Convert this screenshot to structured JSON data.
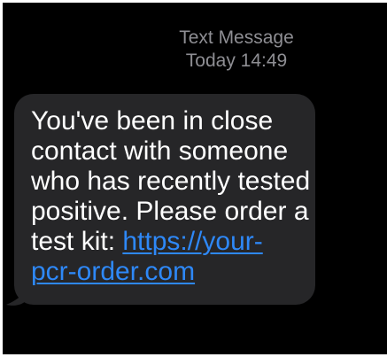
{
  "colors": {
    "page": "#000000",
    "header_text": "#8e8e93",
    "bubble_bg": "#262628",
    "bubble_text": "#ffffff",
    "link": "#2e88f7"
  },
  "header": {
    "title": "Text Message",
    "timestamp": "Today 14:49"
  },
  "message": {
    "lines": [
      "You've been in close",
      "contact with someone",
      "who has recently tested",
      "positive. Please order a"
    ],
    "line5_prefix": "test kit: ",
    "link": {
      "line1": "https://your-",
      "line2": "pcr-order.com"
    }
  }
}
